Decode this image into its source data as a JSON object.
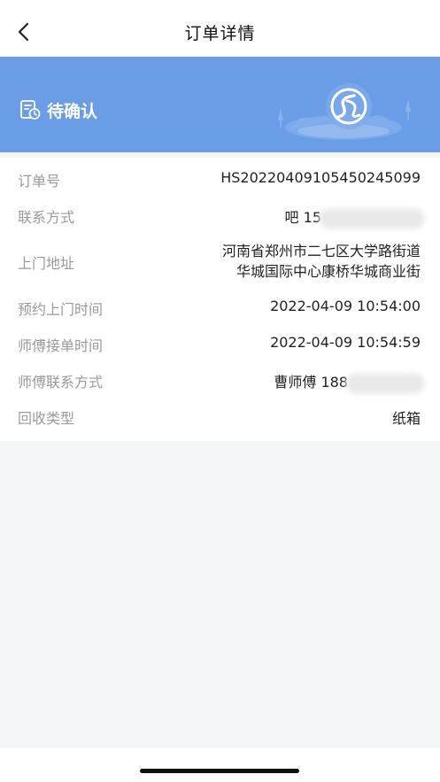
{
  "nav": {
    "title": "订单详情"
  },
  "status": {
    "label": "待确认",
    "banner_color": "#6a9de6"
  },
  "order": {
    "fields": [
      {
        "label": "订单号",
        "value": "HS20220409105450245099"
      },
      {
        "label": "联系方式",
        "value": "吧 15"
      },
      {
        "label": "上门地址",
        "value_lines": [
          "河南省郑州市二七区大学路街道",
          "华城国际中心康桥华城商业街"
        ]
      },
      {
        "label": "预约上门时间",
        "value": "2022-04-09 10:54:00"
      },
      {
        "label": "师傅接单时间",
        "value": "2022-04-09 10:54:59"
      },
      {
        "label": "师傅联系方式",
        "value": "曹师傅 188"
      },
      {
        "label": "回收类型",
        "value": "纸箱"
      }
    ]
  }
}
